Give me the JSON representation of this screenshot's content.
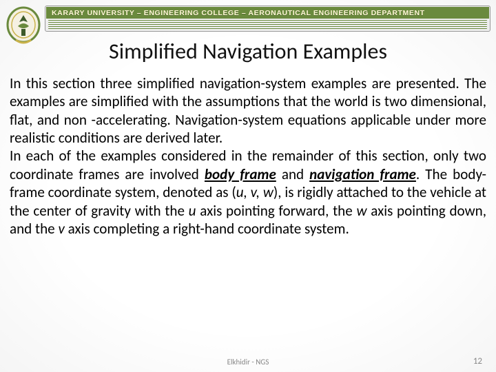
{
  "header": {
    "institution_line": "KARARY UNIVERSITY – ENGINEERING COLLEGE – AERONAUTICAL ENGINEERING DEPARTMENT"
  },
  "slide": {
    "title": "Simplified Navigation Examples"
  },
  "body": {
    "p1_a": "In this section three simplified navigation-system examples are presented. The examples are simplified with the assumptions that the world is two dimensional, flat, and non -accelerating. Navigation-system equations applicable under more realistic conditions are derived later.",
    "p2_lead": "In each of the examples considered in the remainder of this section, only two coordinate frames are involved ",
    "p2_bf": "body frame",
    "p2_and": " and ",
    "p2_nf": "navigation frame",
    "p2_mid1": ". The body-frame coordinate system, denoted as (",
    "p2_u": "u, v, w",
    "p2_mid2": "), is rigidly attached to the vehicle at the center of gravity with the ",
    "p2_u2": "u",
    "p2_mid3": " axis pointing forward, the ",
    "p2_w": "w",
    "p2_mid4": " axis pointing down, and the ",
    "p2_v": "v",
    "p2_mid5": " axis completing a right-hand coordinate system."
  },
  "footer": {
    "center": "Elkhidir - NGS",
    "page": "12"
  }
}
